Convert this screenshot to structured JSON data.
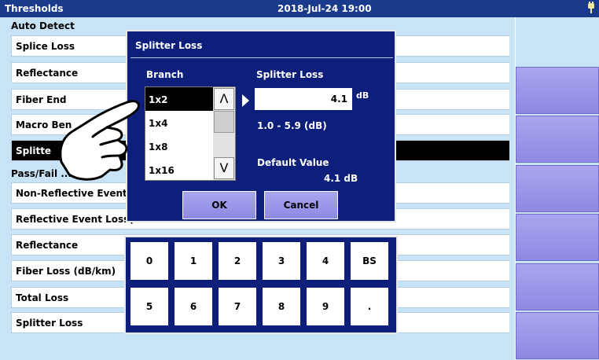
{
  "header": {
    "title": "Thresholds",
    "datetime": "2018-Jul-24 19:00"
  },
  "auto_detect": {
    "heading": "Auto Detect",
    "rows": [
      "Splice Loss",
      "Reflectance",
      "Fiber End",
      "Macro Ben",
      "Splitte"
    ]
  },
  "pass_fail": {
    "heading": "Pass/Fail ",
    "heading_tail": "...holds",
    "rows": [
      "Non-Reflective Event I",
      "Reflective Event Loss(",
      "Reflectance",
      "Fiber Loss (dB/km)",
      "Total Loss",
      "Splitter Loss"
    ]
  },
  "dialog": {
    "title": "Splitter Loss",
    "branch_label": "Branch",
    "splitter_label": "Splitter Loss",
    "branches": [
      "1x2",
      "1x4",
      "1x8",
      "1x16"
    ],
    "selected_branch": "1x2",
    "value": "4.1",
    "unit": "dB",
    "range": "1.0 - 5.9 (dB)",
    "default_label": "Default Value",
    "default_value": "4.1 dB",
    "ok_label": "OK",
    "cancel_label": "Cancel",
    "scroll_up": "Λ",
    "scroll_down": "V"
  },
  "keypad": {
    "row1": [
      "0",
      "1",
      "2",
      "3",
      "4",
      "BS"
    ],
    "row2": [
      "5",
      "6",
      "7",
      "8",
      "9",
      "."
    ]
  },
  "colors": {
    "titlebar": "#1a3a8c",
    "dialog": "#0d1f7a",
    "background": "#c8e3f6",
    "button": "#9a97e9"
  },
  "icons": {
    "power": "plug-icon",
    "pointer": "hand-pointer-icon",
    "arrow": "right-triangle-icon"
  }
}
